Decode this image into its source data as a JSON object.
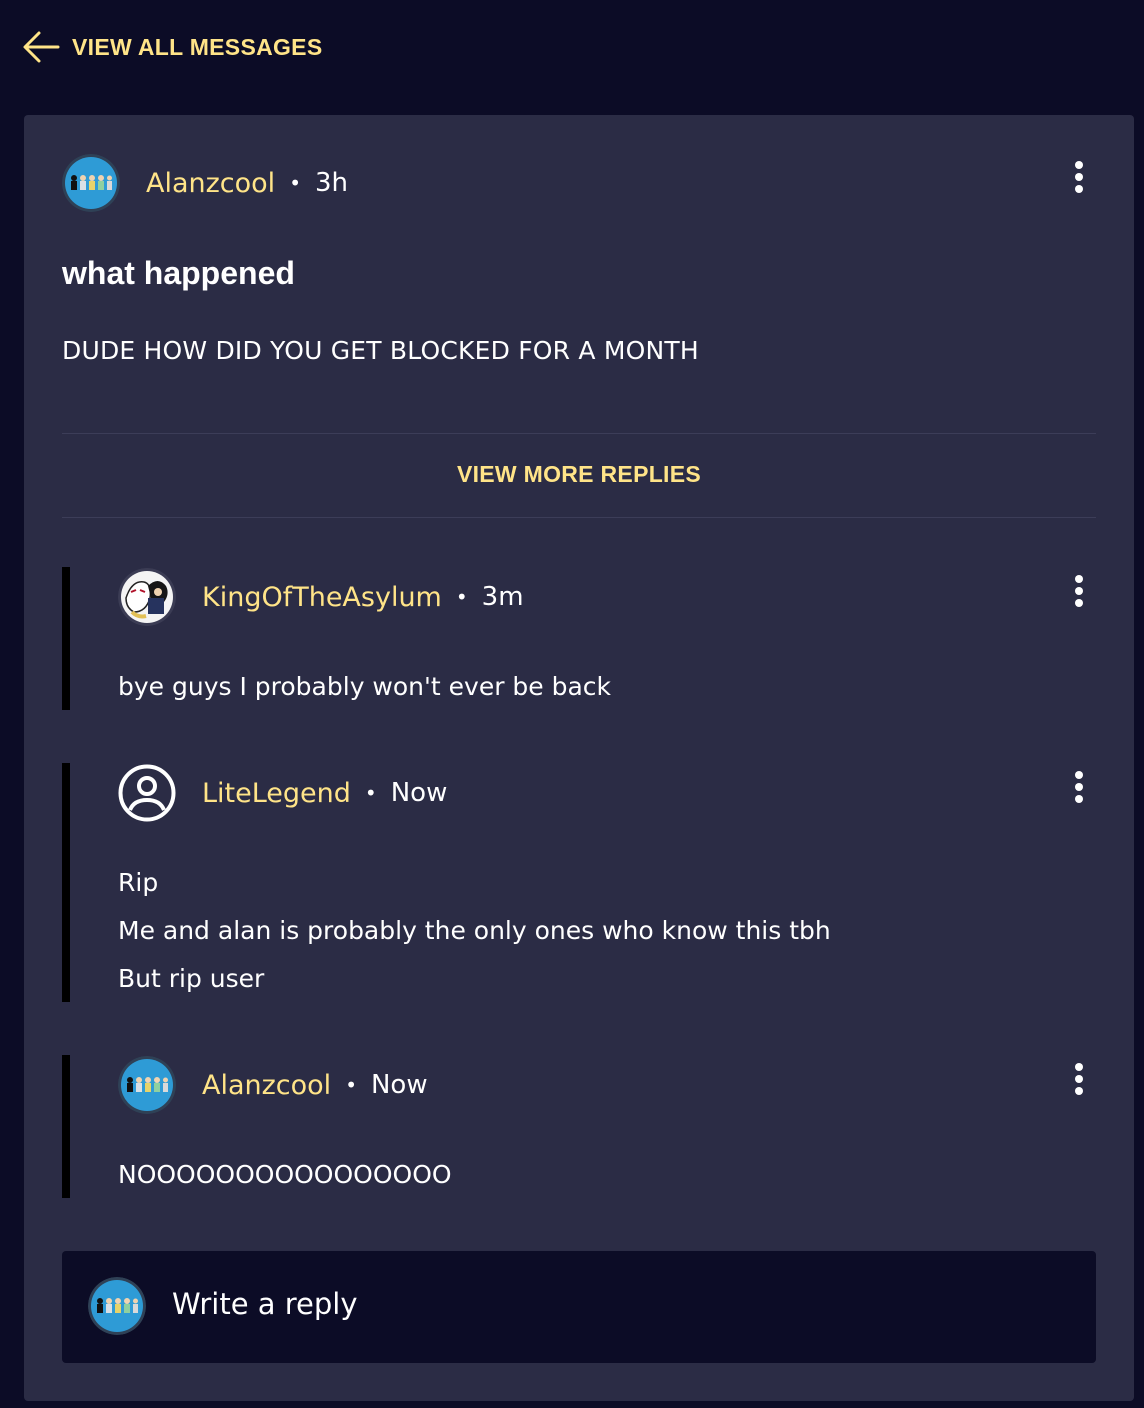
{
  "nav": {
    "back_label": "VIEW ALL MESSAGES"
  },
  "post": {
    "author": "Alanzcool",
    "separator": "•",
    "time": "3h",
    "title": "what happened",
    "body": "DUDE HOW DID YOU GET BLOCKED FOR A MONTH"
  },
  "view_more_label": "VIEW MORE REPLIES",
  "replies": [
    {
      "author": "KingOfTheAsylum",
      "time": "3m",
      "lines": [
        "bye guys I probably won't ever be back"
      ]
    },
    {
      "author": "LiteLegend",
      "time": "Now",
      "lines": [
        "Rip",
        "Me and alan is probably the only ones who know this tbh",
        "But rip user"
      ]
    },
    {
      "author": "Alanzcool",
      "time": "Now",
      "lines": [
        "NOOOOOOOOOOOOOOOO"
      ]
    }
  ],
  "composer": {
    "placeholder": "Write a reply"
  },
  "colors": {
    "page_background": "#0c0c26",
    "card_background": "#2b2c45",
    "accent": "#ffe488",
    "text": "#ffffff"
  },
  "icons": {
    "back": "arrow-left-icon",
    "more": "more-vertical-icon",
    "default_avatar": "user-circle-icon"
  }
}
